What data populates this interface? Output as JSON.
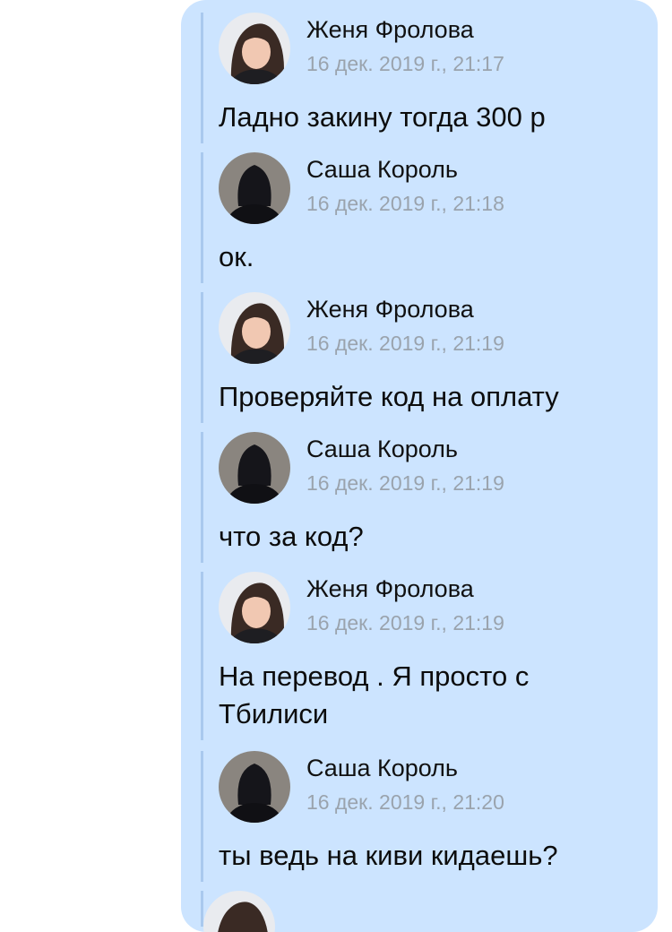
{
  "messages": [
    {
      "author": "Женя Фролова",
      "time": "16 дек. 2019 г., 21:17",
      "text": "Ладно закину тогда 300 р",
      "avatar_icon": "woman-avatar-icon"
    },
    {
      "author": "Саша Король",
      "time": "16 дек. 2019 г., 21:18",
      "text": "ок.",
      "avatar_icon": "hooded-person-avatar-icon"
    },
    {
      "author": "Женя Фролова",
      "time": "16 дек. 2019 г., 21:19",
      "text": "Проверяйте код на оплату",
      "avatar_icon": "woman-avatar-icon"
    },
    {
      "author": "Саша Король",
      "time": "16 дек. 2019 г., 21:19",
      "text": "что за код?",
      "avatar_icon": "hooded-person-avatar-icon"
    },
    {
      "author": "Женя Фролова",
      "time": "16 дек. 2019 г., 21:19",
      "text": "На перевод . Я просто с Тбилиси",
      "avatar_icon": "woman-avatar-icon"
    },
    {
      "author": "Саша Король",
      "time": "16 дек. 2019 г., 21:20",
      "text": "ты ведь на киви кидаешь?",
      "avatar_icon": "hooded-person-avatar-icon"
    }
  ],
  "colors": {
    "bubble_background": "#cce4ff",
    "quote_bar": "#a9c9ee",
    "timestamp": "#9aa3ad"
  }
}
